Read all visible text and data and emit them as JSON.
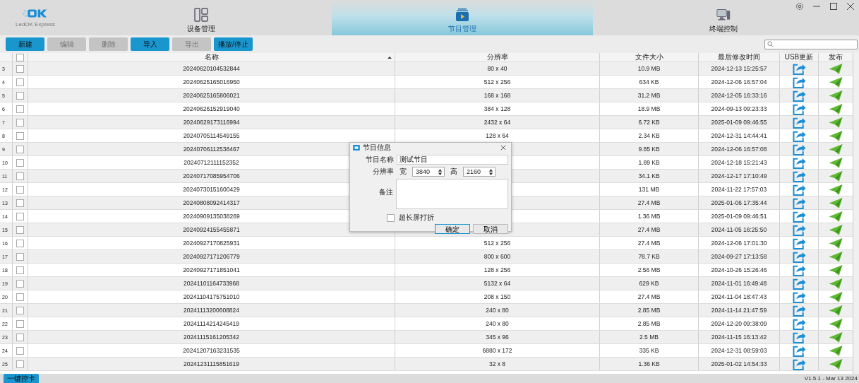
{
  "app": {
    "logo": "LedOK Express",
    "version": "V1.5.1 - Mar 13 2024"
  },
  "tabs": [
    {
      "label": "设备管理",
      "selected": false
    },
    {
      "label": "节目管理",
      "selected": true
    },
    {
      "label": "终端控制",
      "selected": false
    }
  ],
  "toolbar": [
    {
      "label": "新建",
      "disabled": false
    },
    {
      "label": "编辑",
      "disabled": true
    },
    {
      "label": "删除",
      "disabled": true
    },
    {
      "label": "导入",
      "disabled": false
    },
    {
      "label": "导出",
      "disabled": true
    },
    {
      "label": "播放/停止",
      "disabled": false
    }
  ],
  "table": {
    "select_all_checked": false,
    "columns": [
      "名称",
      "分辨率",
      "文件大小",
      "最后修改时间",
      "USB更新",
      "发布"
    ],
    "rows": [
      {
        "index": "3",
        "checked": false,
        "name": "20240620104532844",
        "resolution": "80 x 40",
        "size": "10.9 MB",
        "modified": "2024-12-13 15:25:57"
      },
      {
        "index": "4",
        "checked": false,
        "name": "20240625165016950",
        "resolution": "512 x 256",
        "size": "634 KB",
        "modified": "2024-12-06 16:57:04"
      },
      {
        "index": "5",
        "checked": false,
        "name": "20240625165806021",
        "resolution": "168 x 168",
        "size": "31.2 MB",
        "modified": "2024-12-05 16:33:16"
      },
      {
        "index": "6",
        "checked": false,
        "name": "20240626152919040",
        "resolution": "384 x 128",
        "size": "18.9 MB",
        "modified": "2024-09-13 09:23:33"
      },
      {
        "index": "7",
        "checked": false,
        "name": "20240629173116994",
        "resolution": "2432 x 64",
        "size": "6.72 KB",
        "modified": "2025-01-09 09:46:55"
      },
      {
        "index": "8",
        "checked": false,
        "name": "20240705114549155",
        "resolution": "128 x 64",
        "size": "2.34 KB",
        "modified": "2024-12-31 14:44:41"
      },
      {
        "index": "9",
        "checked": false,
        "name": "20240706112538467",
        "size": "9.85 KB",
        "modified": "2024-12-06 16:57:08"
      },
      {
        "index": "10",
        "checked": false,
        "name": "20240712111152352",
        "size": "1.89 KB",
        "modified": "2024-12-18 15:21:43"
      },
      {
        "index": "11",
        "checked": false,
        "name": "20240717085954706",
        "size": "34.1 KB",
        "modified": "2024-12-17 17:10:49"
      },
      {
        "index": "12",
        "checked": false,
        "name": "20240730151600429",
        "size": "131 MB",
        "modified": "2024-11-22 17:57:03"
      },
      {
        "index": "13",
        "checked": false,
        "name": "20240808092414317",
        "size": "27.4 MB",
        "modified": "2025-01-06 17:35:44"
      },
      {
        "index": "14",
        "checked": false,
        "name": "20240909135038269",
        "size": "1.36 MB",
        "modified": "2025-01-09 09:46:51"
      },
      {
        "index": "15",
        "checked": false,
        "name": "20240924155455871",
        "size": "27.4 MB",
        "modified": "2024-11-05 16:25:50"
      },
      {
        "index": "16",
        "checked": false,
        "name": "20240927170825931",
        "resolution": "512 x 256",
        "size": "27.4 MB",
        "modified": "2024-12-06 17:01:30"
      },
      {
        "index": "17",
        "checked": false,
        "name": "20240927171206779",
        "resolution": "800 x 600",
        "size": "78.7 KB",
        "modified": "2024-09-27 17:13:58"
      },
      {
        "index": "18",
        "checked": false,
        "name": "20240927171851041",
        "resolution": "128 x 256",
        "size": "2.56 MB",
        "modified": "2024-10-26 15:26:46"
      },
      {
        "index": "19",
        "checked": false,
        "name": "20241101164733968",
        "resolution": "5132 x 64",
        "size": "629 KB",
        "modified": "2024-11-01 16:49:48"
      },
      {
        "index": "20",
        "checked": false,
        "name": "20241104175751010",
        "resolution": "208 x 150",
        "size": "27.4 MB",
        "modified": "2024-11-04 18:47:43"
      },
      {
        "index": "21",
        "checked": false,
        "name": "20241113200608824",
        "resolution": "240 x 80",
        "size": "2.85 MB",
        "modified": "2024-11-14 21:47:59"
      },
      {
        "index": "22",
        "checked": false,
        "name": "20241114214245419",
        "resolution": "240 x 80",
        "size": "2.85 MB",
        "modified": "2024-12-20 09:38:09"
      },
      {
        "index": "23",
        "checked": false,
        "name": "20241115161205342",
        "resolution": "345 x 96",
        "size": "2.5 MB",
        "modified": "2024-11-15 16:13:42"
      },
      {
        "index": "24",
        "checked": false,
        "name": "20241207163231535",
        "resolution": "6880 x 172",
        "size": "335 KB",
        "modified": "2024-12-31 08:59:03"
      },
      {
        "index": "25",
        "checked": false,
        "name": "20241231115851619",
        "resolution": "32 x 8",
        "size": "1.36 KB",
        "modified": "2025-01-02 14:54:33"
      }
    ]
  },
  "bottom_button": "一键控卡",
  "dialog": {
    "title": "节目信息",
    "name_label": "节目名称",
    "name_value": "测试节目",
    "resolution_label": "分辨率",
    "width_label": "宽",
    "width_value": "3840",
    "height_label": "高",
    "height_value": "2160",
    "note_label": "备注",
    "fold": {
      "label": "超长屏打折",
      "checked": false
    },
    "buttons": [
      "确定",
      "取消"
    ]
  }
}
